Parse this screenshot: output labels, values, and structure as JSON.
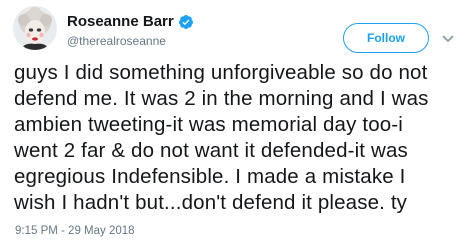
{
  "user": {
    "display_name": "Roseanne Barr",
    "handle": "@therealroseanne",
    "verified": true
  },
  "follow_button": {
    "label": "Follow"
  },
  "tweet": {
    "lines": [
      "guys I did something unforgiveable so do not",
      "defend me. It was 2 in the morning and I was",
      "ambien tweeting-it was memorial day too-i",
      "went 2 far & do not want it defended-it was",
      "egregious Indefensible. I made a mistake I",
      "wish I hadn't but...don't defend it please. ty"
    ],
    "timestamp": "9:15 PM - 29 May 2018"
  },
  "icons": {
    "verified": "verified-badge-icon",
    "menu": "chevron-down-icon"
  },
  "colors": {
    "accent": "#1da1f2",
    "secondary_text": "#657786",
    "primary_text": "#14171a"
  }
}
